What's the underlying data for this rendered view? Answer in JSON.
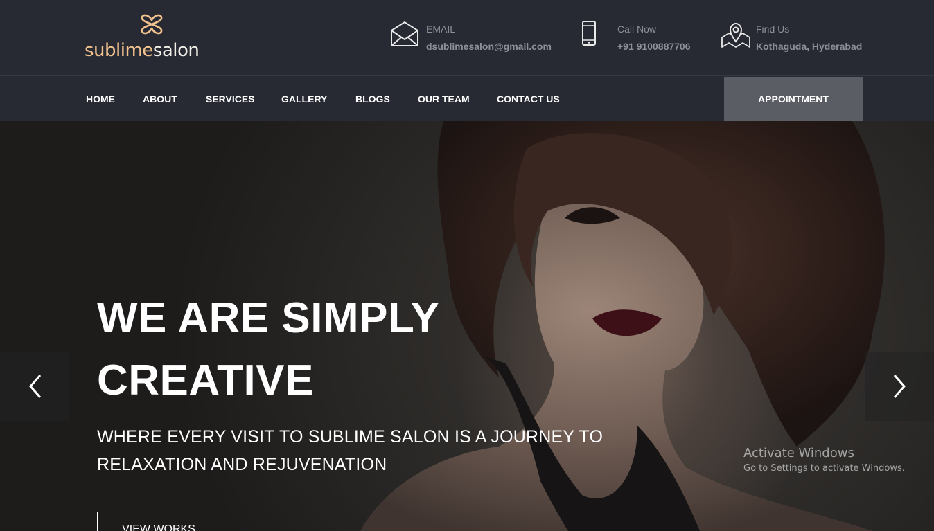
{
  "brand": {
    "logo_part1": "sublime",
    "logo_part2": "salon",
    "accent_color": "#f2c28e",
    "logo_icon": "x-knot-icon"
  },
  "contacts": {
    "email": {
      "icon": "envelope-icon",
      "label": "EMAIL",
      "value": "dsublimesalon@gmail.com"
    },
    "phone": {
      "icon": "mobile-phone-icon",
      "label": "Call Now",
      "value": "+91 9100887706"
    },
    "location": {
      "icon": "map-pin-icon",
      "label": "Find Us",
      "value": "Kothaguda, Hyderabad"
    }
  },
  "nav": {
    "items": [
      "HOME",
      "ABOUT",
      "SERVICES",
      "GALLERY",
      "BLOGS",
      "OUR TEAM",
      "CONTACT US"
    ],
    "cta": "APPOINTMENT"
  },
  "hero": {
    "headline_line1": "WE ARE SIMPLY",
    "headline_line2": "CREATIVE",
    "subline_line1": "WHERE EVERY VISIT TO SUBLIME SALON IS A JOURNEY TO",
    "subline_line2": "RELAXATION AND REJUVENATION",
    "button": "VIEW WORKS",
    "prev_icon": "chevron-left-icon",
    "next_icon": "chevron-right-icon"
  },
  "os_watermark": {
    "title": "Activate Windows",
    "subtitle": "Go to Settings to activate Windows."
  }
}
